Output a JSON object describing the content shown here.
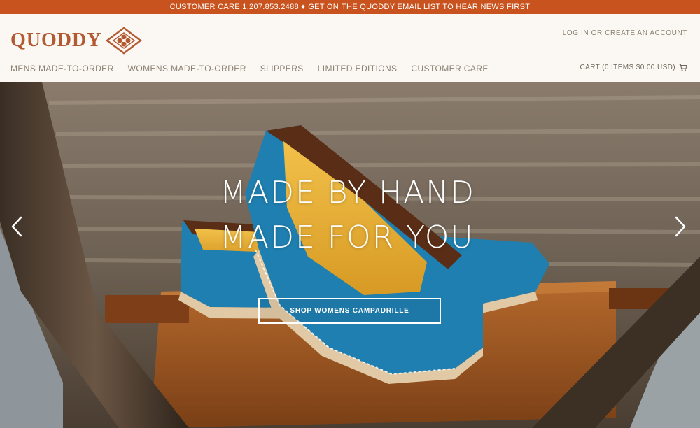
{
  "announcement": {
    "prefix": "CUSTOMER CARE 1.207.853.2488 ♦",
    "link": "GET ON",
    "suffix": "THE QUODDY EMAIL LIST TO HEAR NEWS FIRST"
  },
  "brand": {
    "name": "QUODDY",
    "mark_icon": "quoddy-diamond-logo"
  },
  "account": {
    "login": "LOG IN",
    "sep": "OR",
    "create": "CREATE AN ACCOUNT"
  },
  "nav": {
    "items": [
      {
        "label": "MENS MADE-TO-ORDER"
      },
      {
        "label": "WOMENS MADE-TO-ORDER"
      },
      {
        "label": "SLIPPERS"
      },
      {
        "label": "LIMITED EDITIONS"
      },
      {
        "label": "CUSTOMER CARE"
      }
    ]
  },
  "cart": {
    "label": "CART (0 ITEMS $0.00 USD)",
    "icon": "cart-icon"
  },
  "hero": {
    "line1": "MADE BY HAND",
    "line2": "MADE FOR YOU",
    "cta": "SHOP WOMENS CAMPADRILLE",
    "prev_icon": "chevron-left-icon",
    "next_icon": "chevron-right-icon"
  },
  "colors": {
    "accent": "#c9531e",
    "brand": "#b35a33",
    "nav_text": "#8a7f73",
    "shoe_blue": "#1f7fb0"
  }
}
